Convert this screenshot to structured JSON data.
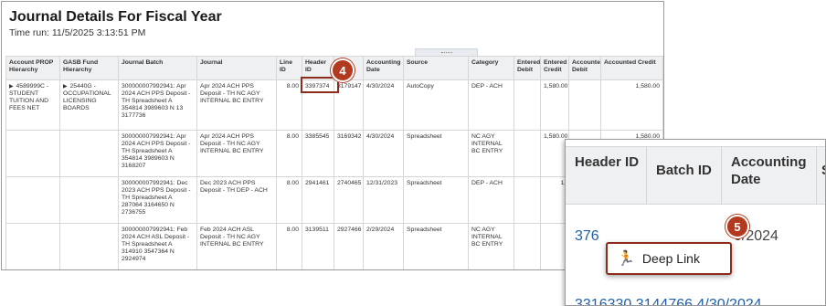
{
  "report": {
    "title": "Journal Details For Fiscal Year",
    "time_run": "Time run: 11/5/2025 3:13:51 PM"
  },
  "table": {
    "headers": [
      "Account PROP Hierarchy",
      "GASB Fund Hierarchy",
      "Journal Batch",
      "Journal",
      "Line ID",
      "Header ID",
      "",
      "Accounting Date",
      "Source",
      "Category",
      "Entered Debit",
      "Entered Credit",
      "Accounted Debit",
      "Accounted Credit"
    ],
    "rows": [
      {
        "account": "4589999C - STUDENT TUITION AND FEES NET",
        "fund": "25440G - OCCUPATIONAL LICENSING BOARDS",
        "batch": "300000007992941: Apr 2024 ACH PPS Deposit - TH Spreadsheet A 354814 3989603 N 13 3177736",
        "journal": "Apr 2024 ACH PPS Deposit - TH NC AGY INTERNAL BC ENTRY",
        "line_id": "8.00",
        "header_id": "3397374",
        "batch_id": "3179147",
        "date": "4/30/2024",
        "source": "AutoCopy",
        "category": "DEP - ACH",
        "entered_debit": "",
        "entered_credit": "1,580.00",
        "accounted_debit": "",
        "accounted_credit": "1,580.00"
      },
      {
        "account": "",
        "fund": "",
        "batch": "300000007992941: Apr 2024 ACH PPS Deposit - TH Spreadsheet A 354814 3989603 N 3168207",
        "journal": "Apr 2024 ACH PPS Deposit - TH NC AGY INTERNAL BC ENTRY",
        "line_id": "8.00",
        "header_id": "3385545",
        "batch_id": "3169342",
        "date": "4/30/2024",
        "source": "Spreadsheet",
        "category": "NC AGY INTERNAL BC ENTRY",
        "entered_debit": "",
        "entered_credit": "1,580.00",
        "accounted_debit": "",
        "accounted_credit": "1,580.00"
      },
      {
        "account": "",
        "fund": "",
        "batch": "300000007992941: Dec 2023 ACH PPS Deposit - TH Spreadsheet A 287064 3164650 N 2736755",
        "journal": "Dec 2023 ACH PPS Deposit - TH DEP - ACH",
        "line_id": "8.00",
        "header_id": "2941461",
        "batch_id": "2740465",
        "date": "12/31/2023",
        "source": "Spreadsheet",
        "category": "DEP - ACH",
        "entered_debit": "",
        "entered_credit": "1,",
        "accounted_debit": "",
        "accounted_credit": ""
      },
      {
        "account": "",
        "fund": "",
        "batch": "300000007992941: Feb 2024 ACH ASL Deposit - TH Spreadsheet A 314910 3547364 N 2924974",
        "journal": "Feb 2024 ACH ASL Deposit - TH NC AGY INTERNAL BC ENTRY",
        "line_id": "8.00",
        "header_id": "3139511",
        "batch_id": "2927466",
        "date": "2/29/2024",
        "source": "Spreadsheet",
        "category": "NC AGY INTERNAL BC ENTRY",
        "entered_debit": "",
        "entered_credit": "",
        "accounted_debit": "",
        "accounted_credit": ""
      }
    ]
  },
  "callouts": {
    "step4": "4",
    "step5": "5"
  },
  "zoom": {
    "header_id_label": "Header ID",
    "batch_id_label": "Batch ID",
    "accounting_date_label": "Accounting Date",
    "extra_header_fragment": "S",
    "link_fragment": "376",
    "date_fragment": "4/30/2024",
    "date_visible": "0/2024",
    "bottom_row_fragment": "3316330  3144766  4/30/2024",
    "deep_link_label": "Deep Link",
    "deep_link_icon": "running-person-icon"
  },
  "colors": {
    "link": "#1f5fa8",
    "callout": "#b43a1f",
    "highlight": "#8b2d1a",
    "deep_link_icon": "#3a9a55"
  }
}
